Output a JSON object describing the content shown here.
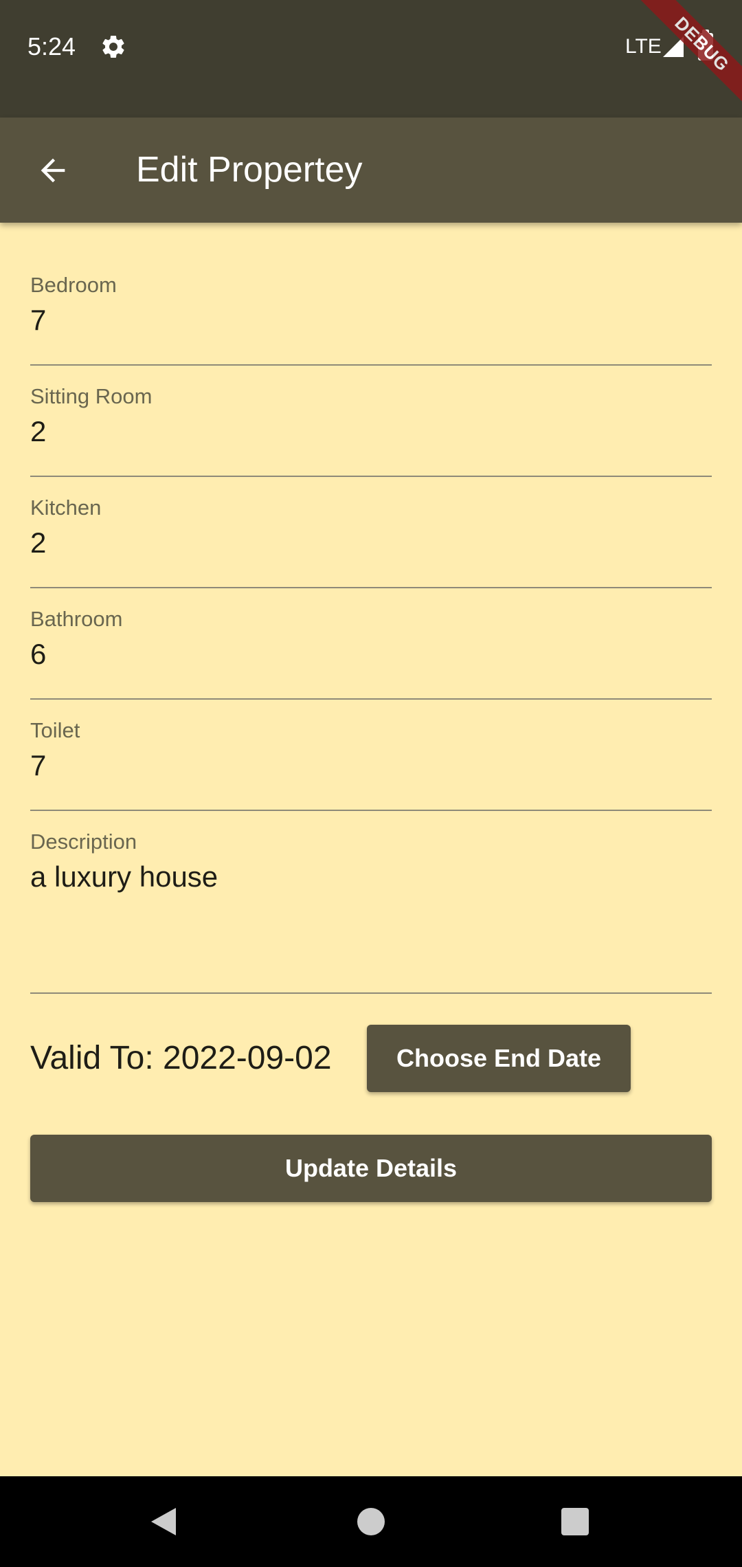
{
  "status_bar": {
    "time": "5:24",
    "settings_icon": "gear-icon",
    "network": "LTE",
    "debug_label": "DEBUG"
  },
  "app_bar": {
    "title": "Edit Propertey",
    "back_icon": "arrow-back-icon"
  },
  "fields": [
    {
      "label": "Bedroom",
      "value": "7"
    },
    {
      "label": "Sitting Room",
      "value": "2"
    },
    {
      "label": "Kitchen",
      "value": "2"
    },
    {
      "label": "Bathroom",
      "value": "6"
    },
    {
      "label": "Toilet",
      "value": "7"
    },
    {
      "label": "Description",
      "value": "a luxury house"
    }
  ],
  "valid_to": {
    "text": "Valid To: 2022-09-02",
    "button_label": "Choose End Date"
  },
  "update_button": {
    "label": "Update Details"
  },
  "colors": {
    "background": "#FFEDB0",
    "app_bar": "#58533F",
    "status_bar": "#403E30",
    "button": "#58533F"
  }
}
